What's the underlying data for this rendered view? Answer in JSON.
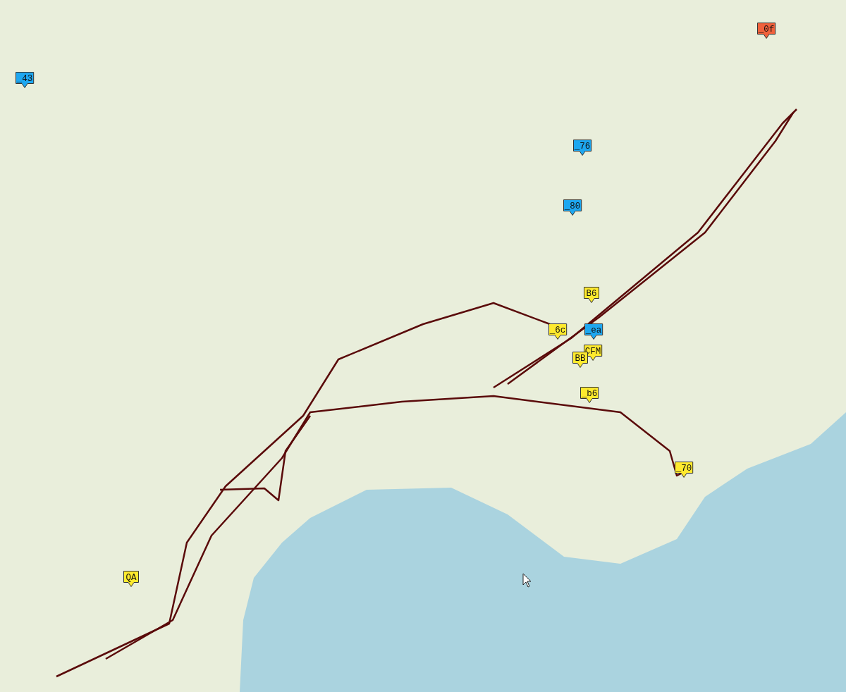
{
  "map": {
    "markers": [
      {
        "label": "_43",
        "color": "#1ea7f0"
      },
      {
        "label": "_0f",
        "color": "#f0613c"
      },
      {
        "label": "_76",
        "color": "#1ea7f0"
      },
      {
        "label": "_80",
        "color": "#1ea7f0"
      },
      {
        "label": "B6",
        "color": "#ffea2e"
      },
      {
        "label": "_6c",
        "color": "#ffea2e"
      },
      {
        "label": "_ea",
        "color": "#1ea7f0"
      },
      {
        "label": "CFM",
        "color": "#ffea2e"
      },
      {
        "label": "BB",
        "color": "#ffea2e"
      },
      {
        "label": "_b6",
        "color": "#ffea2e"
      },
      {
        "label": "_70",
        "color": "#ffea2e"
      },
      {
        "label": "QA",
        "color": "#ffea2e"
      }
    ]
  }
}
